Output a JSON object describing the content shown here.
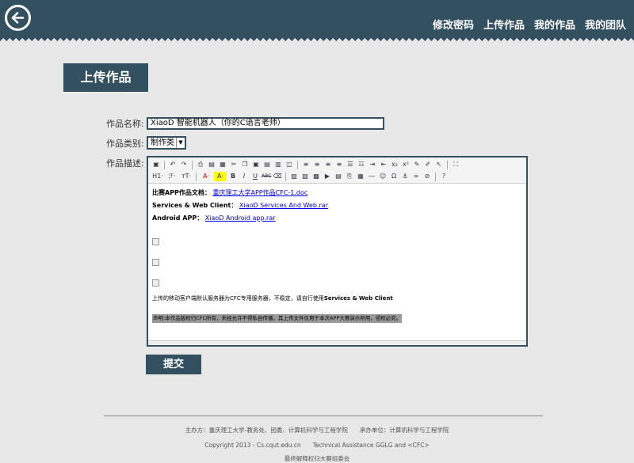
{
  "nav": {
    "items": [
      "修改密码",
      "上传作品",
      "我的作品",
      "我的团队"
    ]
  },
  "page_title": "上传作品",
  "form": {
    "name_label": "作品名称:",
    "name_value": "XiaoD 智能机器人（你的C语言老师）",
    "type_label": "作品类别:",
    "type_value": "制作类",
    "desc_label": "作品描述:"
  },
  "editor": {
    "toolbar_row2_labels": [
      "H1·",
      "ℱ·",
      "тT·",
      "A·",
      "A·",
      "B",
      "I",
      "U",
      "ABC"
    ],
    "lines": [
      {
        "label": "比赛APP作品文档：",
        "link": "重庆理工大学APP作品CFC-1.doc"
      },
      {
        "label": "Services & Web Client：",
        "link": "XiaoD Services And Web.rar"
      },
      {
        "label": "Android APP：",
        "link": "XiaoD Android app.rar"
      }
    ],
    "note_prefix": "上传的移动客户端默认服务器为CFC专用服务器，不稳定，请自行使用",
    "note_bold": "Services & Web Client",
    "notice": "声明:本作品版权归CFC所有，未经允许不得私自传播，其上传文件仅用于本次APP大赛演示所用，侵权必究。"
  },
  "submit_label": "提交",
  "footer": {
    "line1": "主办方：重庆理工大学-教务处、团委、计算机科学与工程学院　　承办单位：计算机科学与工程学院",
    "line2": "Copyright 2013 - Cs.cqut.edu.cn　　Technical Assistance GGLG and <CFC>",
    "line3": "最终解释权归大赛组委会"
  },
  "colors": {
    "accent": "#32505f",
    "background": "#e8e8e8"
  }
}
